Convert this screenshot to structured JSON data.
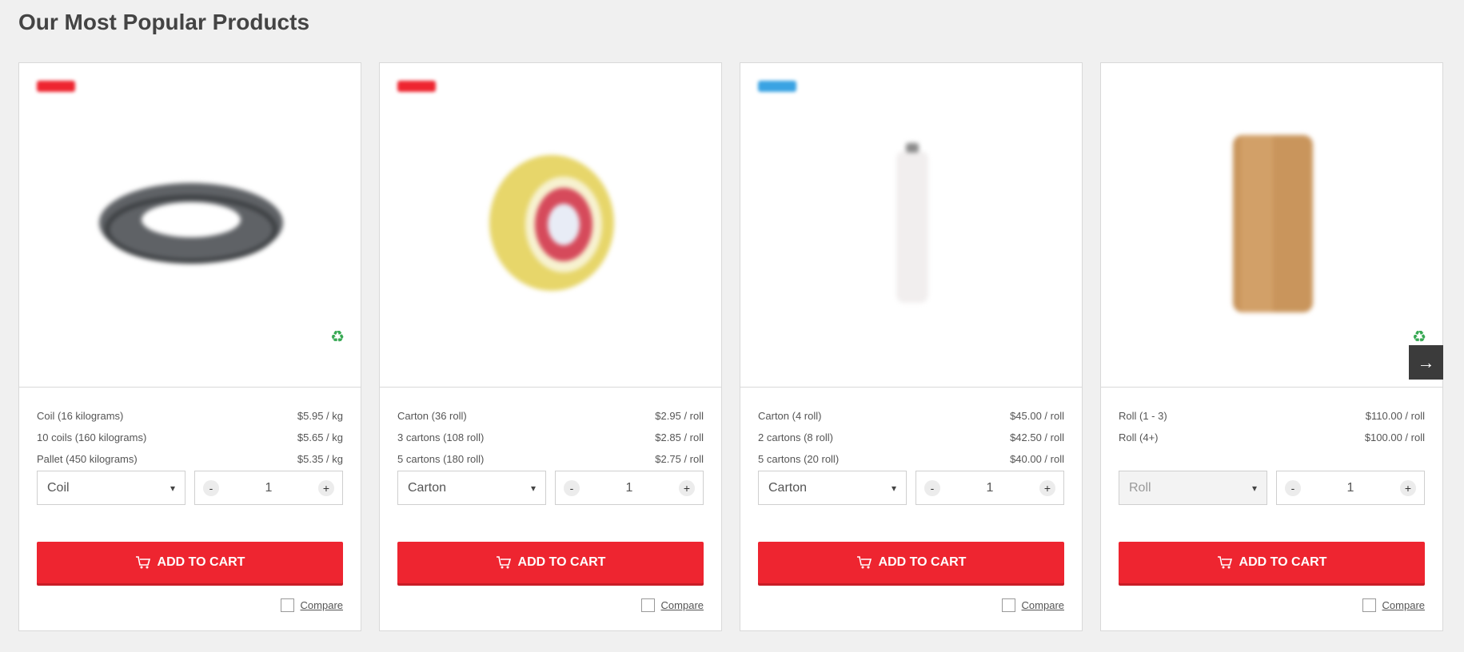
{
  "section": {
    "title": "Our Most Popular Products"
  },
  "colors": {
    "accent": "#ee2530",
    "badge_blue": "#3aa3e3",
    "eco": "#36a852"
  },
  "products": [
    {
      "badge_color": "red",
      "image_icon": "strapping-coil",
      "eco_icon": "recycle-icon",
      "tiers": [
        {
          "label": "Coil (16 kilograms)",
          "price": "$5.95 / kg"
        },
        {
          "label": "10 coils (160 kilograms)",
          "price": "$5.65 / kg"
        },
        {
          "label": "Pallet (450 kilograms)",
          "price": "$5.35 / kg"
        }
      ],
      "unit": "Coil",
      "unit_disabled": false,
      "quantity": "1"
    },
    {
      "badge_color": "red",
      "image_icon": "tape-roll",
      "eco_icon": "",
      "tiers": [
        {
          "label": "Carton (36 roll)",
          "price": "$2.95 / roll"
        },
        {
          "label": "3 cartons (108 roll)",
          "price": "$2.85 / roll"
        },
        {
          "label": "5 cartons (180 roll)",
          "price": "$2.75 / roll"
        }
      ],
      "unit": "Carton",
      "unit_disabled": false,
      "quantity": "1"
    },
    {
      "badge_color": "blue",
      "image_icon": "pallet-wrap-roll",
      "eco_icon": "",
      "tiers": [
        {
          "label": "Carton (4 roll)",
          "price": "$45.00 / roll"
        },
        {
          "label": "2 cartons (8 roll)",
          "price": "$42.50 / roll"
        },
        {
          "label": "5 cartons (20 roll)",
          "price": "$40.00 / roll"
        }
      ],
      "unit": "Carton",
      "unit_disabled": false,
      "quantity": "1"
    },
    {
      "badge_color": "red",
      "image_icon": "kraft-paper-roll",
      "eco_icon": "recycle-icon",
      "tiers": [
        {
          "label": "Roll (1 - 3)",
          "price": "$110.00 / roll"
        },
        {
          "label": "Roll (4+)",
          "price": "$100.00 / roll"
        }
      ],
      "unit": "Roll",
      "unit_disabled": true,
      "quantity": "1"
    }
  ],
  "labels": {
    "add_to_cart": "ADD TO CART",
    "compare": "Compare",
    "minus": "-",
    "plus": "+"
  }
}
